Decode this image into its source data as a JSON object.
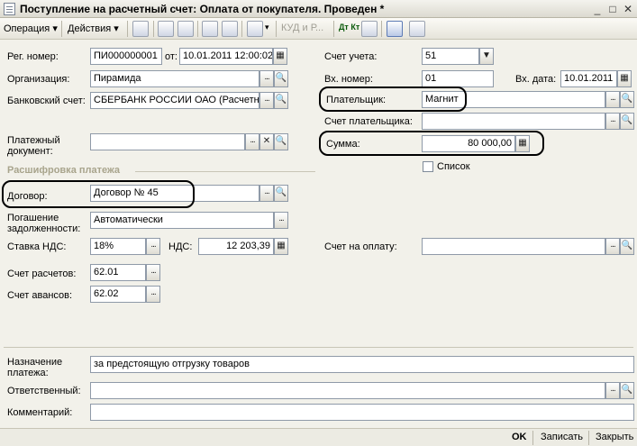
{
  "window": {
    "title": "Поступление на расчетный счет: Оплата от покупателя. Проведен *",
    "minimize": "_",
    "maximize": "□",
    "close": "✕"
  },
  "toolbar": {
    "operation_menu": "Операция ▾",
    "actions_menu": "Действия ▾",
    "kud_label": "КУД и Р...",
    "dt_kt_label": "Дт Кт"
  },
  "form": {
    "reg_number_label": "Рег. номер:",
    "reg_number_value": "ПИ000000001",
    "from_label": "от:",
    "date_value": "10.01.2011 12:00:02",
    "org_label": "Организация:",
    "org_value": "Пирамида",
    "bank_account_label": "Банковский счет:",
    "bank_account_value": "СБЕРБАНК РОССИИ ОАО (Расчетный)",
    "payment_doc_label": "Платежный документ:",
    "payment_doc_value": "",
    "account_label": "Счет учета:",
    "account_value": "51",
    "in_number_label": "Вх. номер:",
    "in_number_value": "01",
    "in_date_label": "Вх. дата:",
    "in_date_value": "10.01.2011",
    "payer_label": "Плательщик:",
    "payer_value": "Магнит",
    "payer_account_label": "Счет плательщика:",
    "payer_account_value": "",
    "sum_label": "Сумма:",
    "sum_value": "80 000,00",
    "list_checkbox_label": "Список",
    "decode_section": "Расшифровка платежа",
    "contract_label": "Договор:",
    "contract_value": "Договор № 45",
    "debt_label": "Погашение задолженности:",
    "debt_value": "Автоматически",
    "vat_rate_label": "Ставка НДС:",
    "vat_rate_value": "18%",
    "vat_label": "НДС:",
    "vat_value": "12 203,39",
    "invoice_label": "Счет на оплату:",
    "invoice_value": "",
    "settle_account_label": "Счет расчетов:",
    "settle_account_value": "62.01",
    "advance_account_label": "Счет авансов:",
    "advance_account_value": "62.02",
    "purpose_label": "Назначение платежа:",
    "purpose_value": "за предстоящую отгрузку товаров",
    "responsible_label": "Ответственный:",
    "responsible_value": "",
    "comment_label": "Комментарий:",
    "comment_value": ""
  },
  "bottom": {
    "ok_label": "OK",
    "save_label": "Записать",
    "close_label": "Закрыть"
  }
}
